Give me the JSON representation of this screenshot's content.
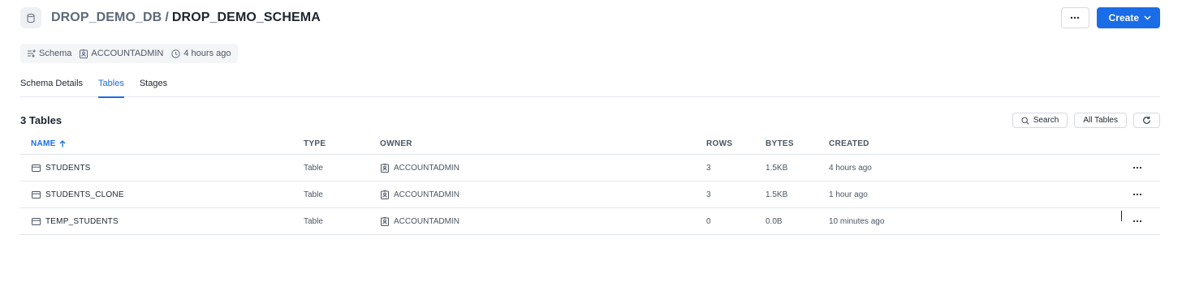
{
  "header": {
    "db_name": "DROP_DEMO_DB",
    "separator": "/",
    "schema_name": "DROP_DEMO_SCHEMA",
    "icon": "database-icon"
  },
  "top_actions": {
    "more_icon": "more-horizontal-icon",
    "create_label": "Create",
    "create_icon": "chevron-down-icon",
    "accent": "#1a6ce7"
  },
  "meta": {
    "type_label": "Schema",
    "owner": "ACCOUNTADMIN",
    "created": "4 hours ago"
  },
  "tabs": [
    {
      "label": "Schema Details",
      "active": false
    },
    {
      "label": "Tables",
      "active": true
    },
    {
      "label": "Stages",
      "active": false
    }
  ],
  "table_count": "3 Tables",
  "tools": {
    "search_label": "Search",
    "filter_label": "All Tables",
    "refresh_icon": "refresh-icon"
  },
  "columns": {
    "name": "NAME",
    "type": "TYPE",
    "owner": "OWNER",
    "rows": "ROWS",
    "bytes": "BYTES",
    "created": "CREATED"
  },
  "rows": [
    {
      "name": "STUDENTS",
      "type": "Table",
      "owner": "ACCOUNTADMIN",
      "rows": "3",
      "bytes": "1.5KB",
      "created": "4 hours ago"
    },
    {
      "name": "STUDENTS_CLONE",
      "type": "Table",
      "owner": "ACCOUNTADMIN",
      "rows": "3",
      "bytes": "1.5KB",
      "created": "1 hour ago"
    },
    {
      "name": "TEMP_STUDENTS",
      "type": "Table",
      "owner": "ACCOUNTADMIN",
      "rows": "0",
      "bytes": "0.0B",
      "created": "10 minutes ago"
    }
  ]
}
